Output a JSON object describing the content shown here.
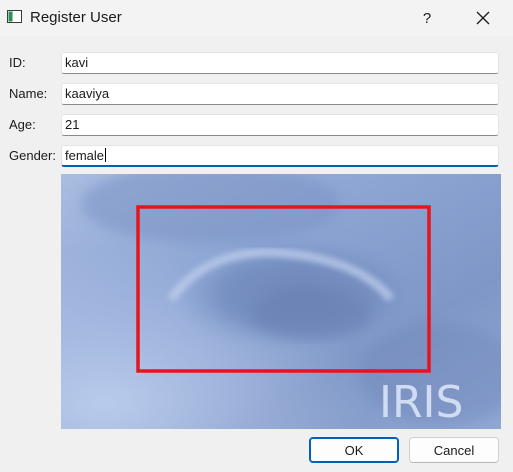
{
  "window": {
    "title": "Register User",
    "help_glyph": "?"
  },
  "form": {
    "id_label": "ID:",
    "id_value": "kavi",
    "name_label": "Name:",
    "name_value": "kaaviya",
    "age_label": "Age:",
    "age_value": "21",
    "gender_label": "Gender:",
    "gender_value": "female"
  },
  "preview": {
    "watermark": "IRIS",
    "detection_box_color": "#e8141c"
  },
  "buttons": {
    "ok_label": "OK",
    "cancel_label": "Cancel"
  },
  "colors": {
    "accent": "#005fb8"
  }
}
